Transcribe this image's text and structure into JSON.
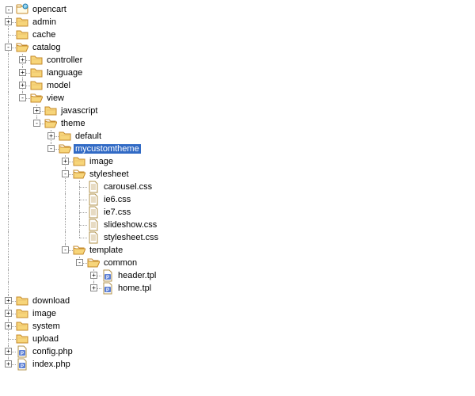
{
  "colors": {
    "selection_bg": "#316ac5",
    "selection_fg": "#ffffff",
    "folder_fill": "#f7d57a",
    "folder_stroke": "#c68a2a",
    "file_fill": "#ffffff",
    "file_stroke": "#b0914a",
    "php_badge": "#5b7fd6"
  },
  "tree": {
    "root": {
      "label": "opencart",
      "icon": "project",
      "expanded": true
    },
    "nodes": [
      {
        "id": "admin",
        "label": "admin",
        "icon": "folder-closed",
        "indent": 1,
        "exp": "plus",
        "lines": "L"
      },
      {
        "id": "cache",
        "label": "cache",
        "icon": "folder-closed",
        "indent": 1,
        "exp": "none",
        "lines": "L"
      },
      {
        "id": "catalog",
        "label": "catalog",
        "icon": "folder-open",
        "indent": 1,
        "exp": "minus",
        "lines": "L"
      },
      {
        "id": "controller",
        "label": "controller",
        "icon": "folder-closed",
        "indent": 2,
        "exp": "plus",
        "lines": "IL"
      },
      {
        "id": "language",
        "label": "language",
        "icon": "folder-closed",
        "indent": 2,
        "exp": "plus",
        "lines": "IL"
      },
      {
        "id": "model",
        "label": "model",
        "icon": "folder-closed",
        "indent": 2,
        "exp": "plus",
        "lines": "IL"
      },
      {
        "id": "view",
        "label": "view",
        "icon": "folder-open",
        "indent": 2,
        "exp": "minus",
        "lines": "IE"
      },
      {
        "id": "javascript",
        "label": "javascript",
        "icon": "folder-closed",
        "indent": 3,
        "exp": "plus",
        "lines": "I L"
      },
      {
        "id": "theme",
        "label": "theme",
        "icon": "folder-open",
        "indent": 3,
        "exp": "minus",
        "lines": "I E"
      },
      {
        "id": "default",
        "label": "default",
        "icon": "folder-closed",
        "indent": 4,
        "exp": "plus",
        "lines": "I  L"
      },
      {
        "id": "mycustomtheme",
        "label": "mycustomtheme",
        "icon": "folder-open",
        "indent": 4,
        "exp": "minus",
        "lines": "I  E",
        "selected": true
      },
      {
        "id": "image",
        "label": "image",
        "icon": "folder-closed",
        "indent": 5,
        "exp": "plus",
        "lines": "I   L"
      },
      {
        "id": "stylesheet",
        "label": "stylesheet",
        "icon": "folder-open",
        "indent": 5,
        "exp": "minus",
        "lines": "I   L"
      },
      {
        "id": "carousel",
        "label": "carousel.css",
        "icon": "file",
        "indent": 6,
        "exp": "none",
        "lines": "I   IL"
      },
      {
        "id": "ie6",
        "label": "ie6.css",
        "icon": "file",
        "indent": 6,
        "exp": "none",
        "lines": "I   IL"
      },
      {
        "id": "ie7",
        "label": "ie7.css",
        "icon": "file",
        "indent": 6,
        "exp": "none",
        "lines": "I   IL"
      },
      {
        "id": "slideshow",
        "label": "slideshow.css",
        "icon": "file",
        "indent": 6,
        "exp": "none",
        "lines": "I   IL"
      },
      {
        "id": "stylesheetcss",
        "label": "stylesheet.css",
        "icon": "file",
        "indent": 6,
        "exp": "none",
        "lines": "I   IE"
      },
      {
        "id": "template",
        "label": "template",
        "icon": "folder-open",
        "indent": 5,
        "exp": "minus",
        "lines": "I   E"
      },
      {
        "id": "common",
        "label": "common",
        "icon": "folder-open",
        "indent": 6,
        "exp": "minus",
        "lines": "I    E"
      },
      {
        "id": "header",
        "label": "header.tpl",
        "icon": "file-php",
        "indent": 7,
        "exp": "plus",
        "lines": "I     L"
      },
      {
        "id": "home",
        "label": "home.tpl",
        "icon": "file-php",
        "indent": 7,
        "exp": "plus",
        "lines": "I     E"
      },
      {
        "id": "download",
        "label": "download",
        "icon": "folder-closed",
        "indent": 1,
        "exp": "plus",
        "lines": "L"
      },
      {
        "id": "image2",
        "label": "image",
        "icon": "folder-closed",
        "indent": 1,
        "exp": "plus",
        "lines": "L"
      },
      {
        "id": "system",
        "label": "system",
        "icon": "folder-closed",
        "indent": 1,
        "exp": "plus",
        "lines": "L"
      },
      {
        "id": "upload",
        "label": "upload",
        "icon": "folder-closed",
        "indent": 1,
        "exp": "none",
        "lines": "L"
      },
      {
        "id": "config",
        "label": "config.php",
        "icon": "file-php",
        "indent": 1,
        "exp": "plus",
        "lines": "L"
      },
      {
        "id": "index",
        "label": "index.php",
        "icon": "file-php",
        "indent": 1,
        "exp": "plus",
        "lines": "E"
      }
    ]
  }
}
